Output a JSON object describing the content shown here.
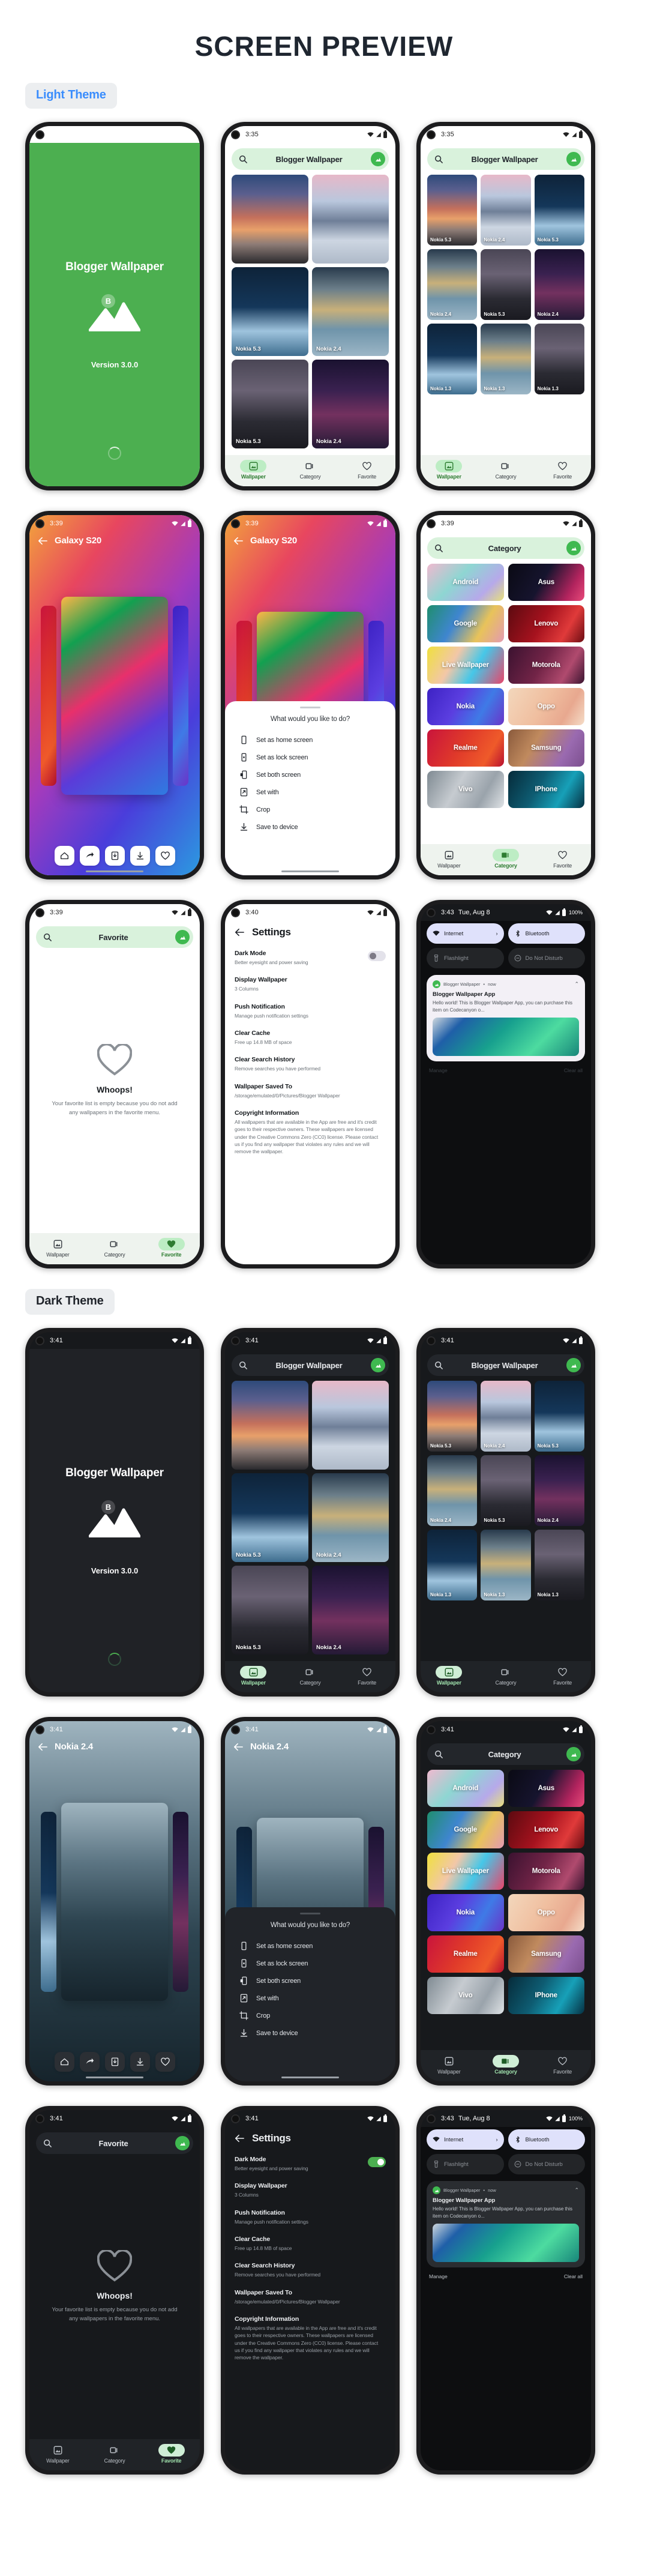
{
  "page": {
    "title": "SCREEN PREVIEW"
  },
  "sections": [
    {
      "badge": "Light Theme"
    },
    {
      "badge": "Dark Theme"
    }
  ],
  "app": {
    "name": "Blogger Wallpaper",
    "version_label": "Version 3.0.0",
    "logo_letter": "B"
  },
  "status": {
    "time_335": "3:35",
    "time_339": "3:39",
    "time_340": "3:40",
    "time_341": "3:41",
    "time_343": "3:43",
    "date": "Tue, Aug 8",
    "battery_pct": "100%"
  },
  "search": {
    "wallpaper_title": "Blogger Wallpaper",
    "category_title": "Category",
    "favorite_title": "Favorite",
    "icon": "search-icon",
    "avatar_icon": "app-logo-icon"
  },
  "bottom_nav": {
    "items": [
      {
        "label": "Wallpaper",
        "icon": "wallpaper-icon"
      },
      {
        "label": "Category",
        "icon": "category-icon"
      },
      {
        "label": "Favorite",
        "icon": "heart-icon"
      }
    ]
  },
  "wallpaper_grid_2col": [
    {
      "label": "",
      "img": "img-sunsetcliff"
    },
    {
      "label": "",
      "img": "img-snowmtn"
    },
    {
      "label": "Nokia 5.3",
      "img": "img-iceberg"
    },
    {
      "label": "Nokia 2.4",
      "img": "img-lakemtn"
    },
    {
      "label": "Nokia 5.3",
      "img": "img-nightcliff"
    },
    {
      "label": "Nokia 2.4",
      "img": "img-galaxy"
    }
  ],
  "wallpaper_grid_3col": [
    {
      "label": "Nokia 5.3",
      "img": "img-sunsetcliff"
    },
    {
      "label": "Nokia 2.4",
      "img": "img-snowmtn"
    },
    {
      "label": "Nokia 5.3",
      "img": "img-iceberg"
    },
    {
      "label": "Nokia 2.4",
      "img": "img-lakemtn"
    },
    {
      "label": "Nokia 5.3",
      "img": "img-nightcliff"
    },
    {
      "label": "Nokia 2.4",
      "img": "img-galaxy"
    },
    {
      "label": "Nokia 1.3",
      "img": "img-iceberg"
    },
    {
      "label": "Nokia 1.3",
      "img": "img-lakemtn"
    },
    {
      "label": "Nokia 1.3",
      "img": "img-nightcliff"
    }
  ],
  "detail": {
    "title_light": "Galaxy S20",
    "title_dark": "Nokia 2.4",
    "actions": [
      {
        "icon": "home-icon"
      },
      {
        "icon": "share-icon"
      },
      {
        "icon": "set-wallpaper-icon"
      },
      {
        "icon": "download-icon"
      },
      {
        "icon": "heart-icon"
      }
    ]
  },
  "sheet": {
    "question": "What would you like to do?",
    "options": [
      {
        "label": "Set as home screen",
        "icon": "phone-icon"
      },
      {
        "label": "Set as lock screen",
        "icon": "phone-lock-icon"
      },
      {
        "label": "Set both screen",
        "icon": "phone-both-icon"
      },
      {
        "label": "Set with",
        "icon": "external-icon"
      },
      {
        "label": "Crop",
        "icon": "crop-icon"
      },
      {
        "label": "Save to device",
        "icon": "download-icon"
      }
    ]
  },
  "categories": [
    {
      "label": "Android",
      "img": "img-cat-android"
    },
    {
      "label": "Asus",
      "img": "img-cat-asus"
    },
    {
      "label": "Google",
      "img": "img-cat-google"
    },
    {
      "label": "Lenovo",
      "img": "img-cat-lenovo"
    },
    {
      "label": "Live Wallpaper",
      "img": "img-cat-live"
    },
    {
      "label": "Motorola",
      "img": "img-cat-moto"
    },
    {
      "label": "Nokia",
      "img": "img-cat-nokia"
    },
    {
      "label": "Oppo",
      "img": "img-cat-oppo"
    },
    {
      "label": "Realme",
      "img": "img-cat-realme"
    },
    {
      "label": "Samsung",
      "img": "img-cat-samsung"
    },
    {
      "label": "Vivo",
      "img": "img-cat-vivo"
    },
    {
      "label": "IPhone",
      "img": "img-cat-iphone"
    }
  ],
  "favorite_empty": {
    "heading": "Whoops!",
    "body": "Your favorite list is empty because you do not add any wallpapers in the favorite menu.",
    "icon": "heart-outline-icon"
  },
  "settings": {
    "title": "Settings",
    "back_icon": "arrow-left-icon",
    "rows": [
      {
        "title": "Dark Mode",
        "sub": "Better eyesight and power saving",
        "toggle": true
      },
      {
        "title": "Display Wallpaper",
        "sub": "3 Columns",
        "toggle": false
      },
      {
        "title": "Push Notification",
        "sub": "Manage push notification settings",
        "toggle": false
      },
      {
        "title": "Clear Cache",
        "sub": "Free up 14.8 MB of space",
        "toggle": false
      },
      {
        "title": "Clear Search History",
        "sub": "Remove searches you have performed",
        "toggle": false
      },
      {
        "title": "Wallpaper Saved To",
        "sub": "/storage/emulated/0/Pictures/Blogger Wallpaper",
        "toggle": false
      },
      {
        "title": "Copyright Information",
        "sub": "All wallpapers that are available in the App are free and it's credit goes to their respective owners. These wallpapers are licensed under the Creative Commons Zero (CC0) license. Please contact us if you find any wallpaper that violates any rules and we will remove the wallpaper.",
        "toggle": false
      }
    ]
  },
  "shade": {
    "tiles": [
      {
        "label": "Internet",
        "icon": "wifi-icon",
        "state": "on",
        "chevron": "›"
      },
      {
        "label": "Bluetooth",
        "icon": "bluetooth-icon",
        "state": "on",
        "chevron": ""
      },
      {
        "label": "Flashlight",
        "icon": "flashlight-icon",
        "state": "off",
        "chevron": ""
      },
      {
        "label": "Do Not Disturb",
        "icon": "dnd-icon",
        "state": "off",
        "chevron": ""
      }
    ],
    "notification": {
      "app": "Blogger Wallpaper",
      "meta_sep": "•",
      "time": "now",
      "title": "Blogger Wallpaper App",
      "body": "Hello world! This is Blogger Wallpaper App, you can purchase this item on Codecanyon o...",
      "expand_icon": "chevron-up-icon",
      "image": "img-teal"
    },
    "actions": {
      "manage": "Manage",
      "clear_all": "Clear all"
    }
  }
}
